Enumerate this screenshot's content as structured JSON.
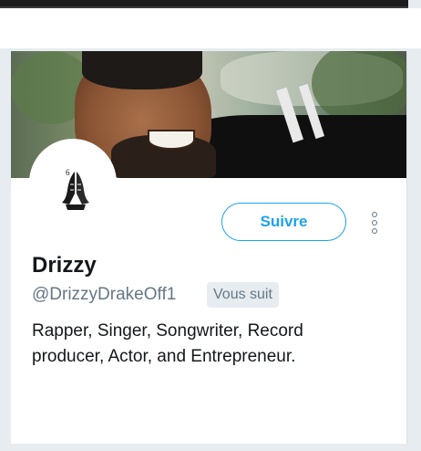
{
  "profile": {
    "name": "Drizzy",
    "handle": "@DrizzyDrakeOff1",
    "follows_you_badge": "Vous suit",
    "bio_line1": "Rapper, Singer, Songwriter, Record",
    "bio_line2": "producer, Actor, and Entrepreneur.",
    "avatar_logo_number": "6"
  },
  "actions": {
    "follow_label": "Suivre",
    "more_icon": "more-vertical-icon"
  },
  "colors": {
    "accent": "#1da1f2",
    "text_primary": "#14171a",
    "text_secondary": "#657786",
    "badge_bg": "#e6ecf0"
  }
}
